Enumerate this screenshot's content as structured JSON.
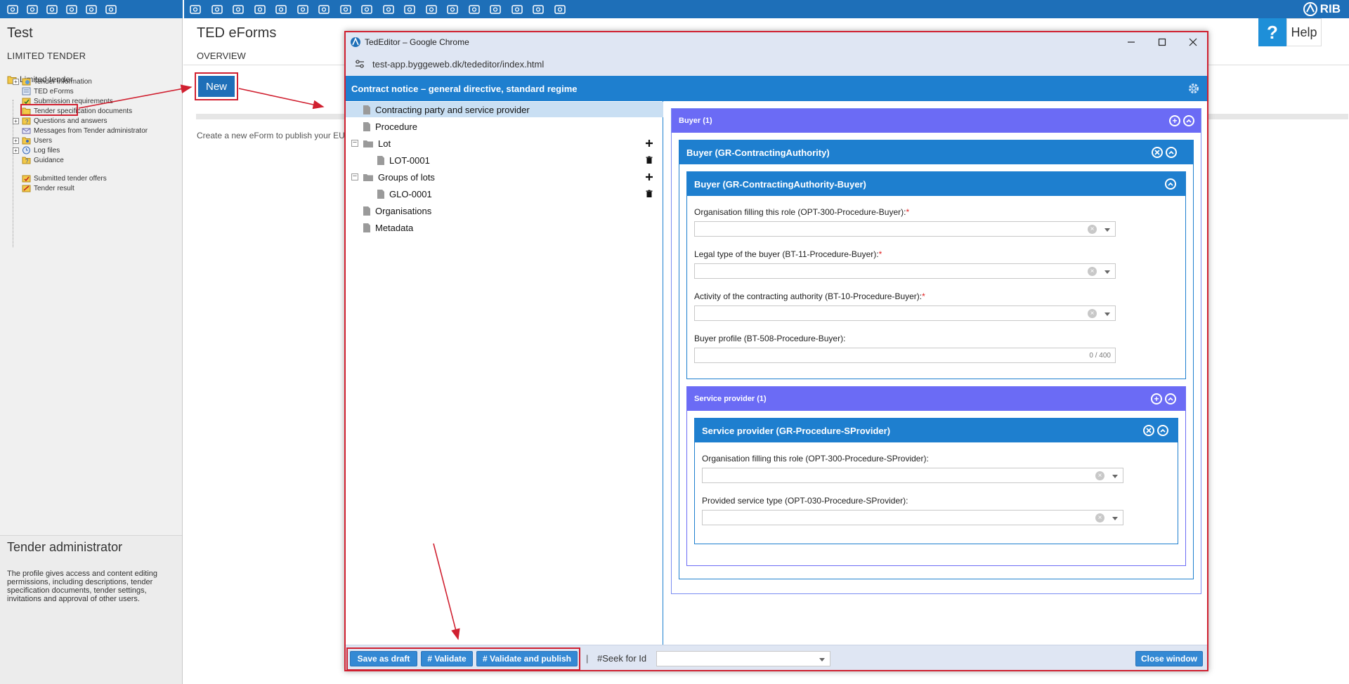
{
  "left_panel": {
    "title": "Test",
    "subtitle": "LIMITED TENDER",
    "tree_root": "Limited tender",
    "tree_items": [
      {
        "label": "Tender information",
        "expandable": true
      },
      {
        "label": "TED eForms",
        "expandable": false,
        "selected": true
      },
      {
        "label": "Submission requirements",
        "expandable": false
      },
      {
        "label": "Tender specification documents",
        "expandable": false
      },
      {
        "label": "Questions and answers",
        "expandable": true
      },
      {
        "label": "Messages from Tender administrator",
        "expandable": false
      },
      {
        "label": "Users",
        "expandable": true
      },
      {
        "label": "Log files",
        "expandable": true
      },
      {
        "label": "Guidance",
        "expandable": false
      },
      {
        "label": "Submitted tender offers",
        "expandable": false
      },
      {
        "label": "Tender result",
        "expandable": false
      }
    ],
    "admin_title": "Tender administrator",
    "admin_text": "The profile gives access and content editing permissions, including descriptions, tender specification documents, tender settings, invitations and approval of other users."
  },
  "main": {
    "title": "TED eForms",
    "subtitle": "OVERVIEW",
    "new_button": "New",
    "description": "Create a new eForm to publish your EU",
    "help_icon": "?",
    "help_label": "Help"
  },
  "brand": {
    "logo_text": "RIB"
  },
  "chrome": {
    "window_title": "TedEditor – Google Chrome",
    "url": "test-app.byggeweb.dk/tededitor/index.html"
  },
  "editor": {
    "header_title": "Contract notice – general directive, standard regime",
    "tree": {
      "contracting": "Contracting party and service provider",
      "procedure": "Procedure",
      "lot": "Lot",
      "lot_child": "LOT-0001",
      "groups": "Groups of lots",
      "groups_child": "GLO-0001",
      "organisations": "Organisations",
      "metadata": "Metadata"
    },
    "buyer_group": "Buyer (1)",
    "buyer_authority": "Buyer (GR-ContractingAuthority)",
    "buyer_inner": "Buyer (GR-ContractingAuthority-Buyer)",
    "fields": {
      "org_role": "Organisation filling this role (OPT-300-Procedure-Buyer):",
      "legal_type": "Legal type of the buyer (BT-11-Procedure-Buyer):",
      "activity": "Activity of the contracting authority (BT-10-Procedure-Buyer):",
      "buyer_profile": "Buyer profile (BT-508-Procedure-Buyer):",
      "buyer_profile_counter": "0 / 400",
      "required_mark": "*"
    },
    "sp_group": "Service provider (1)",
    "sp_inner": "Service provider (GR-Procedure-SProvider)",
    "sp_fields": {
      "org_role": "Organisation filling this role (OPT-300-Procedure-SProvider):",
      "service_type": "Provided service type (OPT-030-Procedure-SProvider):"
    },
    "bottom": {
      "save_draft": "Save as draft",
      "validate": "# Validate",
      "validate_publish": "# Validate and publish",
      "pipe": "|",
      "seek_label": "#Seek for Id",
      "close": "Close window"
    }
  },
  "colors": {
    "toolbar_blue": "#1e6fb8",
    "header_blue": "#1e7fcf",
    "group_purple": "#6b6bf5",
    "highlight_red": "#d02030"
  }
}
